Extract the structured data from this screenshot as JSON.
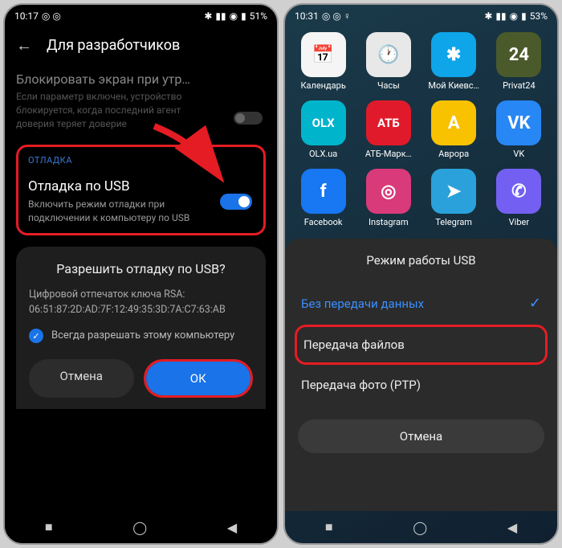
{
  "phone1": {
    "status": {
      "time": "10:17",
      "battery": "51%"
    },
    "header": {
      "title": "Для разработчиков"
    },
    "lock_setting": {
      "title": "Блокировать экран при утр…",
      "desc": "Если параметр включен, устройство блокируется, когда последний агент доверия теряет доверие"
    },
    "debug_section": {
      "label": "ОТЛАДКА",
      "title": "Отладка по USB",
      "desc": "Включить режим отладки при подключении к компьютеру по USB"
    },
    "dialog": {
      "title": "Разрешить отладку по USB?",
      "fingerprint_label": "Цифровой отпечаток ключа RSA:",
      "fingerprint": "06:51:87:2D:AD:7F:12:49:35:3D:7A:C7:63:AB",
      "always_allow": "Всегда разрешать этому компьютеру",
      "cancel": "Отмена",
      "ok": "ОК"
    }
  },
  "phone2": {
    "status": {
      "time": "10:31",
      "battery": "53%"
    },
    "apps": [
      {
        "label": "Календарь",
        "bg": "#f5f5f5",
        "glyph": "📅"
      },
      {
        "label": "Часы",
        "bg": "#e8e8e8",
        "glyph": "🕐"
      },
      {
        "label": "Мой Киевс…",
        "bg": "#0ea5e9",
        "glyph": "✱"
      },
      {
        "label": "Privat24",
        "bg": "#4a5a2a",
        "glyph": "24"
      },
      {
        "label": "OLX.ua",
        "bg": "#00b4cc",
        "glyph": "OLX"
      },
      {
        "label": "АТБ-Марк…",
        "bg": "#e01a2b",
        "glyph": "АТБ"
      },
      {
        "label": "Аврора",
        "bg": "#f8c200",
        "glyph": "A"
      },
      {
        "label": "VK",
        "bg": "#2787f5",
        "glyph": "VK"
      },
      {
        "label": "Facebook",
        "bg": "#1877f2",
        "glyph": "f"
      },
      {
        "label": "Instagram",
        "bg": "#d83a7a",
        "glyph": "◎"
      },
      {
        "label": "Telegram",
        "bg": "#2aa1da",
        "glyph": "➤"
      },
      {
        "label": "Viber",
        "bg": "#7360f2",
        "glyph": "✆"
      }
    ],
    "sheet": {
      "title": "Режим работы USB",
      "options": [
        {
          "label": "Без передачи данных",
          "selected": true
        },
        {
          "label": "Передача файлов",
          "selected": false,
          "highlighted": true
        },
        {
          "label": "Передача фото (PTP)",
          "selected": false
        }
      ],
      "cancel": "Отмена"
    }
  }
}
